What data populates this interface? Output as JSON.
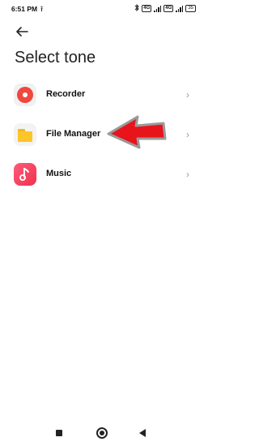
{
  "status_bar": {
    "time": "6:51 PM",
    "upload_icon": "upload-arrow-icon",
    "bluetooth_icon": "bluetooth-icon",
    "sim1_badge": "4G",
    "network_badge": "4G",
    "sim2_badge": "4G",
    "battery_level": "35"
  },
  "header": {
    "back_icon": "arrow-left-icon",
    "title": "Select tone"
  },
  "tone_sources": [
    {
      "label": "Recorder",
      "icon": "recorder-icon"
    },
    {
      "label": "File Manager",
      "icon": "folder-icon"
    },
    {
      "label": "Music",
      "icon": "music-note-icon"
    }
  ],
  "chevron_glyph": "›",
  "annotation": {
    "icon": "red-arrow-icon",
    "color": "#e8141b"
  },
  "nav_bar": {
    "recents_icon": "square-icon",
    "home_icon": "circle-icon",
    "back_icon": "triangle-back-icon"
  }
}
